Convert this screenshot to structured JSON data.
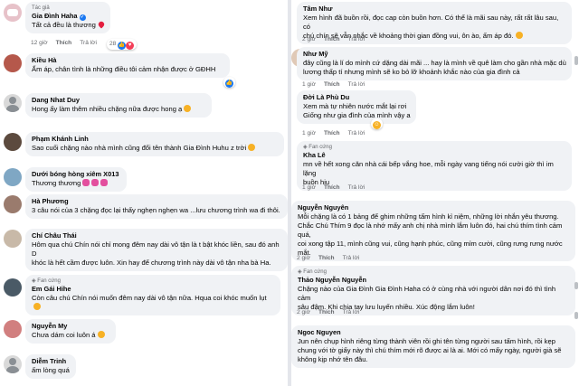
{
  "left": {
    "comments": [
      {
        "author": "Gia Đình Haha",
        "badge": "Tác giả",
        "text": "Tất cả đều là thương",
        "time": "12 giờ",
        "like": "Thích",
        "reply": "Trả lời",
        "reaction_count": "28",
        "verified": true,
        "emoji": "heart"
      },
      {
        "author": "Kiều Hà",
        "text": "Ấm áp, chân tình là những điều tôi cảm nhận được ở GĐHH",
        "reaction": "like"
      },
      {
        "author": "Dang Nhat Duy",
        "text": "Hong ấy làm thêm nhiều chặng nữa được hong ạ",
        "emoji": "smile"
      },
      {
        "author": "Phạm Khánh Linh",
        "text": "Sao cuối chặng nào nhà mình cũng đổi tên thành Gia Đình Huhu z trời",
        "emoji": "cry"
      },
      {
        "author": "Dưới bóng hòng xiêm X013",
        "text": "Thương thương",
        "emoji": "hearts"
      },
      {
        "author": "Hà Phương",
        "text": "3 câu nói của 3 chặng đọc lại thấy nghẹn nghẹn wa ...lưu chương trình wa đi thôi."
      },
      {
        "author": "Chí Châu Thái",
        "text": "Hôm qua chú Chín nói chỉ mong đêm nay dài vô tận là t bật khóc liền, sau đó anh D\nkhóc là hết cầm được luôn. Xin hay để chương trình này dài vô tận nha bà Ha."
      },
      {
        "author": "Em Gái Hihe",
        "badge": "Fan cứng",
        "text": "Còn câu chú Chín nói muốn đêm nay dài vô tận nữa. Hqua coi khóc muốn lụt",
        "emoji": "cry"
      },
      {
        "author": "Nguyễn My",
        "text": "Chưa dám coi luôn á",
        "emoji": "cry"
      },
      {
        "author": "Diễm Trinh",
        "text": "ấm lòng quá"
      }
    ]
  },
  "right": {
    "comments": [
      {
        "author": "Tâm Như",
        "text": "Xem hình đã buồn rồi, đọc cap còn buồn hơn. Có thể là mãi sau này, rất rất lâu sau, có\nchú chín sẽ vẫn nhắc về khoảng thời gian đồng vui, ôn ào, ấm áp đó.",
        "time": "2 giờ",
        "like": "Thích",
        "reply": "Trả lời",
        "emoji": "cry"
      },
      {
        "author": "Như Mỹ",
        "text": "đây cũng là lí do mình cứ dặng dài mãi ... hay là mình về quê làm cho gần nhà mặc dù\nlương thấp tí nhưng mình sẽ ko bỏ lỡ khoảnh khắc nào của gia đình cả",
        "time": "1 giờ",
        "like": "Thích",
        "reply": "Trả lời"
      },
      {
        "author": "Đời Là Phù Du",
        "text": "Xem mà tự nhiên nước mắt lại rơi\nGiống như gia đình của mình vậy a",
        "time": "1 giờ",
        "like": "Thích",
        "reply": "Trả lời"
      },
      {
        "author": "Kha Lê",
        "badge": "Fan cứng",
        "text": "mn về hết xong căn nhà cái bếp vắng hoe, mỗi ngày vang tiếng nói cười giờ thì im lặng\nbuồn hiu",
        "time": "1 giờ",
        "like": "Thích",
        "reply": "Trả lời"
      },
      {
        "author": "Nguyễn Nguyên",
        "text": "Mỗi chặng là có 1 bảng để ghim những tấm hình kỉ niệm, những lời nhắn yêu thương.\nChắc Chú Thím 9 đọc là nhớ mấy anh chị nhà mình lắm luôn đó, hai chú thím tình cảm quá,\ncoi xong tập 11, mình cũng vui, cũng hạnh phúc, cũng mỉm cười, cũng rưng rưng nước\nmắt.",
        "time": "2 giờ",
        "like": "Thích",
        "reply": "Trả lời"
      },
      {
        "author": "Thảo Nguyễn Nguyễn",
        "badge": "Fan cứng",
        "text": "Chặng nào của Gia Đình Gia Đình Haha có ở cùng nhà với người dân nơi đó thì tình cảm\nsâu đậm. Khi chia tay lưu luyến nhiều. Xúc động lắm luôn!",
        "time": "2 giờ",
        "like": "Thích",
        "reply": "Trả lời"
      },
      {
        "author": "Ngoc Nguyen",
        "text": "Jun nên chụp hình riêng từng thành viên rồi ghi tên từng người sau tấm hình, rồi kẹp\nchung với tờ giấy này thì chú thím mới rõ được ai là ai. Mới có mấy ngày, người già sẽ\nkhông kịp nhớ tên đâu."
      }
    ]
  }
}
